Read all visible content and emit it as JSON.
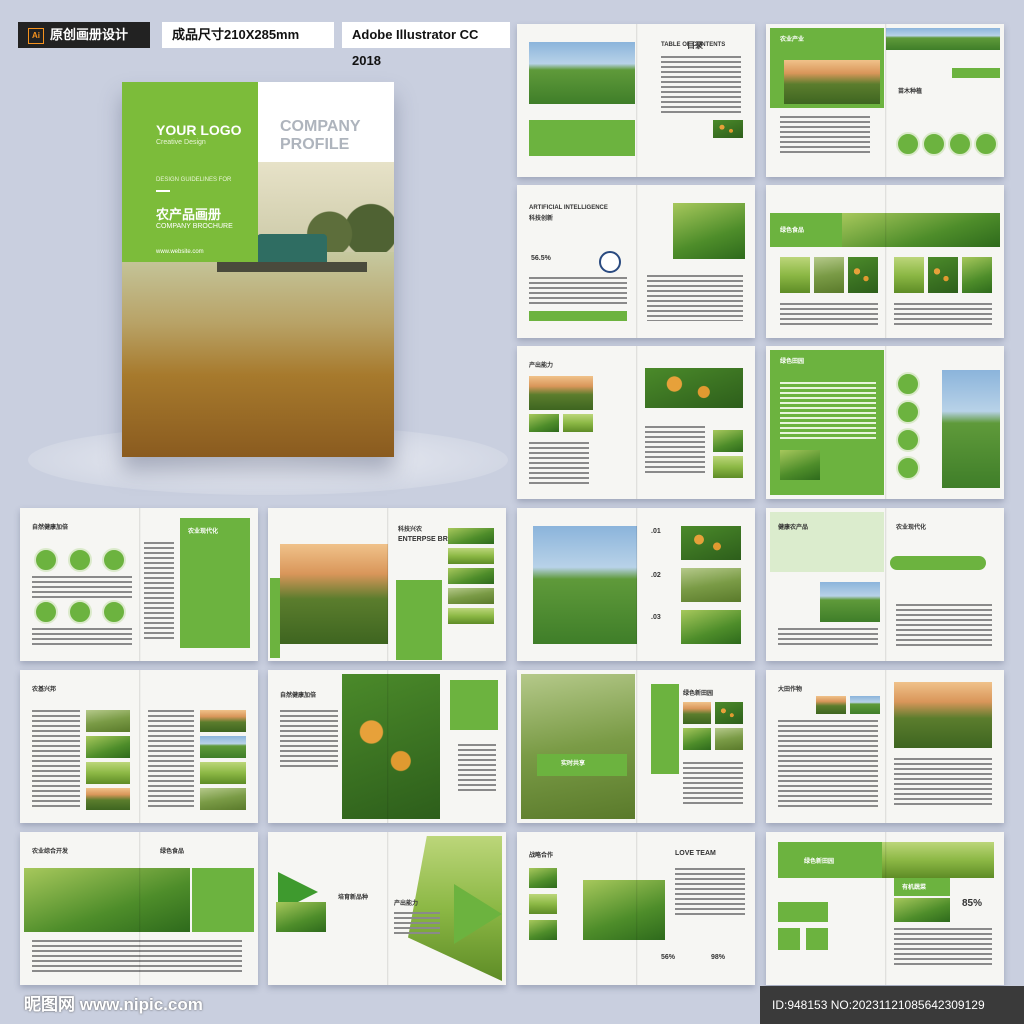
{
  "header": {
    "ai_badge": "Ai",
    "tag_design": "原创画册设计",
    "tag_size": "成品尺寸210X285mm",
    "tag_software": "Adobe Illustrator CC 2018"
  },
  "cover": {
    "logo": "YOUR LOGO",
    "logo_sub": "Creative Design",
    "company_line1": "COMPANY",
    "company_line2": "PROFILE",
    "guides": "DESIGN GUIDELINES FOR",
    "cn_title": "农产品画册",
    "brochure": "COMPANY BROCHURE",
    "website": "www.website.com"
  },
  "spreads": {
    "s1_title": "目录",
    "s1_sub": "TABLE OF CONTENTS",
    "s2_title": "农业产业",
    "s2_title2": "苗木种植",
    "s3_title": "ARTIFICIAL INTELLIGENCE",
    "s3_title_cn": "科技创新",
    "s3_stat": "56.5%",
    "s4_title": "绿色食品",
    "s5_title": "产出能力",
    "s6_title": "绿色田园",
    "s7_title": "自然健康加倍",
    "s7_title2": "农业现代化",
    "s8_title": "科技兴农",
    "s8_sub": "ENTERPSE BRAND",
    "s9_n1": ".01",
    "s9_n2": ".02",
    "s9_n3": ".03",
    "s10_title": "健康农产品",
    "s10_title2": "农业现代化",
    "s11_title": "农基兴邦",
    "s12_title": "自然健康加倍",
    "s13_banner": "实时共享",
    "s13_title": "绿色新田园",
    "s14_title": "大田作物",
    "s15_title": "农业综合开发",
    "s15_title2": "绿色食品",
    "s16_title": "培育新品种",
    "s16_title2": "产出能力",
    "s17_title": "战略合作",
    "s17_title2": "LOVE TEAM",
    "s17_stat1": "56%",
    "s17_stat2": "98%",
    "s18_title": "绿色新田园",
    "s18_title2": "有机蔬菜",
    "s18_stat": "85%"
  },
  "footer": {
    "watermark": "昵图网 www.nipic.com",
    "id": "ID:948153 NO:20231121085642309129"
  },
  "colors": {
    "accent": "#6cb33f",
    "dark_accent": "#3e9a2e",
    "background": "#c9cfdf"
  }
}
